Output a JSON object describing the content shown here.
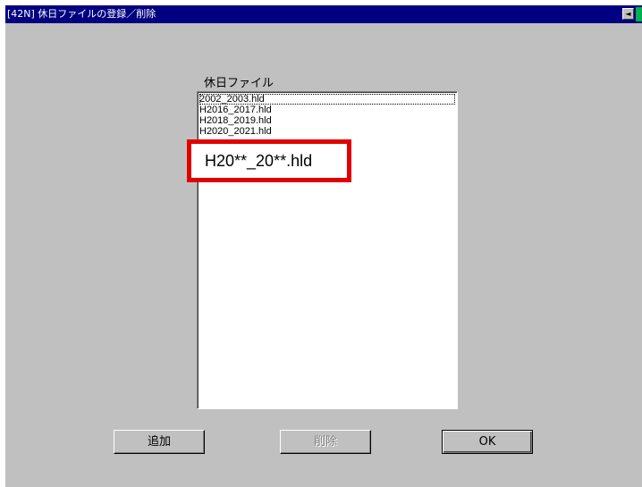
{
  "window": {
    "title": "[42N] 休日ファイルの登録／削除",
    "title_bar_color": "#000080",
    "background_color": "#c0c0c0"
  },
  "titlebar_controls": {
    "scroll_left_icon": "◄",
    "scroll_left_icon_name": "scroll-left-arrow-icon",
    "accent_color": "#00b050"
  },
  "file_list": {
    "label": "休日ファイル",
    "items": [
      "2002_2003.hld",
      "H2016_2017.hld",
      "H2018_2019.hld",
      "H2020_2021.hld"
    ],
    "focused_index": 0
  },
  "callout": {
    "text": "H20**_20**.hld",
    "border_color": "#e00000"
  },
  "buttons": {
    "add": {
      "label": "追加",
      "enabled": true
    },
    "delete": {
      "label": "削除",
      "enabled": false
    },
    "ok": {
      "label": "OK",
      "enabled": true,
      "default": true
    }
  }
}
